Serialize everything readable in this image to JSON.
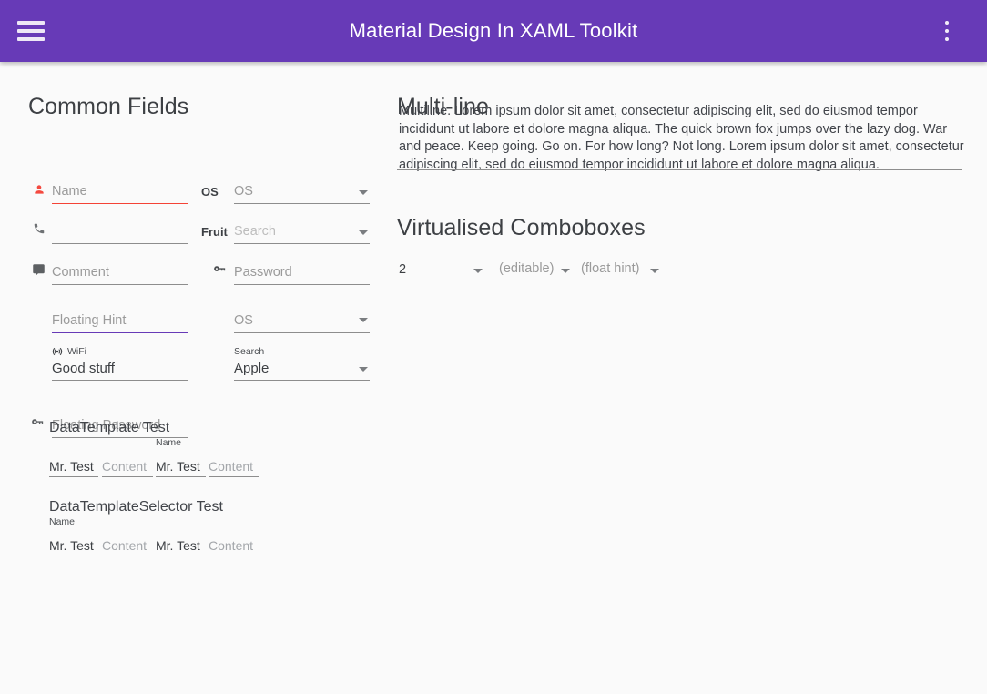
{
  "app_bar": {
    "menu_icon": "hamburger-menu-icon",
    "title": "Material Design In XAML Toolkit",
    "overflow_icon": "vertical-dots-icon"
  },
  "colors": {
    "primary": "#673ab7",
    "accent_underline": "#673ab7",
    "error": "#f44336",
    "page_background": "#fafafa",
    "hint_text": "#9a9a9a",
    "body_text": "#41444a"
  },
  "left_column": {
    "title": "Common Fields",
    "fields": [
      {
        "name": "name-field",
        "icon": "person-icon",
        "hint": "Name",
        "value": ""
      },
      {
        "name": "phone-field",
        "icon": "phone-icon",
        "hint": "",
        "value": ""
      },
      {
        "name": "comment-field",
        "icon": "comment-icon",
        "hint": "Comment",
        "value": ""
      },
      {
        "name": "floating-hint-field",
        "icon": "",
        "hint": "Floating Hint",
        "value": ""
      },
      {
        "name": "wifi-field",
        "icon": "wifi-icon",
        "float_label": "WiFi",
        "value": "Good stuff"
      },
      {
        "name": "floating-password-field",
        "icon": "key-icon",
        "hint": "Floating Password",
        "value": ""
      }
    ],
    "combo_fields": [
      {
        "name": "os-combobox",
        "prefix": "OS",
        "hint": "OS",
        "value": ""
      },
      {
        "name": "fruit-combobox",
        "prefix": "Fruit",
        "hint": "Search",
        "value": ""
      },
      {
        "name": "password-field",
        "prefix": "",
        "icon": "key-icon",
        "hint": "Password",
        "value": ""
      },
      {
        "name": "os-combobox-2",
        "prefix": "",
        "hint": "OS",
        "value": ""
      },
      {
        "name": "search-combobox",
        "prefix": "",
        "float_label": "Search",
        "value": "Apple"
      }
    ],
    "data_template": {
      "title": "DataTemplate Test",
      "cells": [
        {
          "text": "Mr. Test",
          "muted": false,
          "float_label": ""
        },
        {
          "text": "Content",
          "muted": true,
          "float_label": ""
        },
        {
          "text": "Mr. Test",
          "muted": false,
          "float_label": "Name"
        },
        {
          "text": "Content",
          "muted": true,
          "float_label": ""
        }
      ]
    },
    "data_template_selector": {
      "title": "DataTemplateSelector Test",
      "cells": [
        {
          "text": "Mr. Test",
          "muted": false,
          "float_label": "Name"
        },
        {
          "text": "Content",
          "muted": true,
          "float_label": ""
        },
        {
          "text": "Mr. Test",
          "muted": false,
          "float_label": ""
        },
        {
          "text": "Content",
          "muted": true,
          "float_label": ""
        }
      ]
    }
  },
  "right_column": {
    "multiline": {
      "title": "Multi-line",
      "text": "Multiline. Lorem ipsum dolor sit amet, consectetur adipiscing elit, sed do eiusmod tempor incididunt ut labore et dolore magna aliqua. The quick brown fox jumps over the lazy dog. War and peace. Keep going. Go on. For how long? Not long. Lorem ipsum dolor sit amet, consectetur adipiscing elit, sed do eiusmod tempor incididunt ut labore et dolore magna aliqua."
    },
    "virtualised": {
      "title": "Virtualised Comboboxes",
      "comboboxes": [
        {
          "name": "virtualised-combobox-number",
          "value": "2",
          "muted": false
        },
        {
          "name": "virtualised-combobox-editable",
          "value": "(editable)",
          "muted": true
        },
        {
          "name": "virtualised-combobox-floathint",
          "value": "(float hint)",
          "muted": true
        }
      ]
    }
  }
}
